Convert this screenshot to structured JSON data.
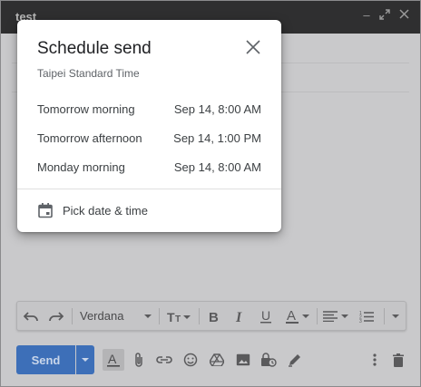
{
  "compose": {
    "title": "test"
  },
  "dialog": {
    "title": "Schedule send",
    "timezone": "Taipei Standard Time",
    "options": [
      {
        "label": "Tomorrow morning",
        "datetime": "Sep 14, 8:00 AM"
      },
      {
        "label": "Tomorrow afternoon",
        "datetime": "Sep 14, 1:00 PM"
      },
      {
        "label": "Monday morning",
        "datetime": "Sep 14, 8:00 AM"
      }
    ],
    "pick_label": "Pick date & time"
  },
  "toolbar": {
    "font": "Verdana"
  },
  "bottom": {
    "send_label": "Send"
  },
  "colors": {
    "send_button": "#3d6fb8",
    "overlay_compose": "#c9c9cb",
    "titlebar": "#2f2f30"
  }
}
